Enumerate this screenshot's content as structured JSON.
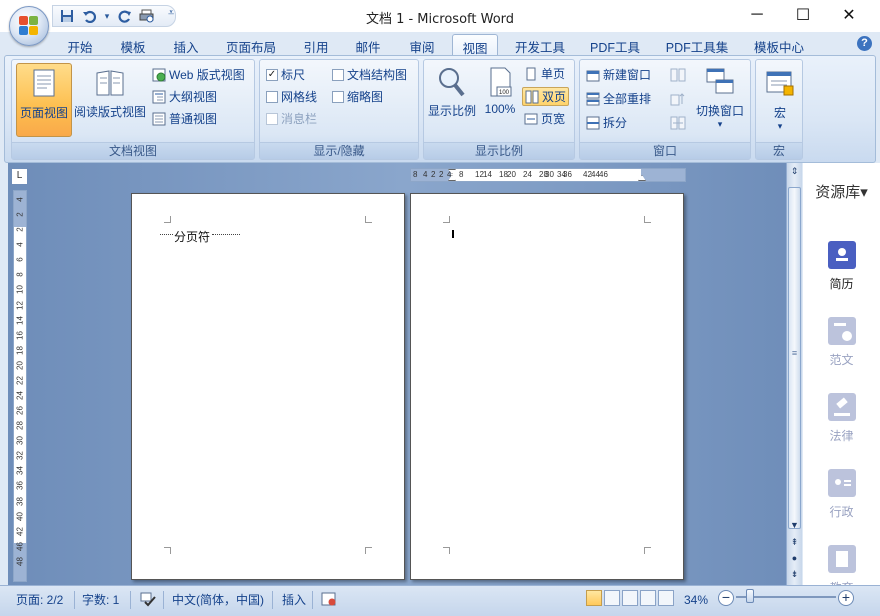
{
  "window": {
    "title": "文档 1 - Microsoft Word",
    "minimize_glyph": "─",
    "maximize_glyph": "☐",
    "close_glyph": "✕"
  },
  "quick_access": {
    "icons": [
      "save-icon",
      "undo-icon",
      "redo-icon",
      "print-preview-icon",
      "customize-dropdown-icon"
    ],
    "dropdown_glyph": "▾",
    "customize_glyph": "⩡"
  },
  "tabs": [
    {
      "label": "开始",
      "active": false
    },
    {
      "label": "模板",
      "active": false
    },
    {
      "label": "插入",
      "active": false
    },
    {
      "label": "页面布局",
      "active": false
    },
    {
      "label": "引用",
      "active": false
    },
    {
      "label": "邮件",
      "active": false
    },
    {
      "label": "审阅",
      "active": false
    },
    {
      "label": "视图",
      "active": true
    },
    {
      "label": "开发工具",
      "active": false
    },
    {
      "label": "PDF工具",
      "active": false
    },
    {
      "label": "PDF工具集",
      "active": false
    },
    {
      "label": "模板中心",
      "active": false
    }
  ],
  "help_glyph": "?",
  "ribbon": {
    "doc_views": {
      "label": "文档视图",
      "page_view": "页面视图",
      "reading_view": "阅读版式视图",
      "web_view": "Web 版式视图",
      "outline_view": "大纲视图",
      "draft_view": "普通视图"
    },
    "show_hide": {
      "label": "显示/隐藏",
      "ruler": "标尺",
      "ruler_checked": true,
      "gridlines": "网格线",
      "gridlines_checked": false,
      "message_bar": "消息栏",
      "message_bar_checked": false,
      "doc_map": "文档结构图",
      "doc_map_checked": false,
      "thumbnails": "缩略图",
      "thumbnails_checked": false,
      "check_glyph": "✓"
    },
    "zoom": {
      "label": "显示比例",
      "zoom_btn": "显示比例",
      "percent_btn": "100%",
      "percent_icon_text": "100",
      "one_page": "单页",
      "two_pages": "双页",
      "page_width": "页宽"
    },
    "window": {
      "label": "窗口",
      "new_window": "新建窗口",
      "arrange_all": "全部重排",
      "split": "拆分",
      "switch_windows": "切换窗口",
      "dropdown_glyph": "▾"
    },
    "macros": {
      "label": "宏",
      "macros_btn": "宏",
      "dropdown_glyph": "▾"
    }
  },
  "rulers": {
    "tab_selector": "L",
    "h_ticks": [
      "8",
      "4",
      "2",
      "2",
      "4",
      "8",
      "12",
      "14",
      "18",
      "20",
      "24",
      "28",
      "30",
      "34",
      "36",
      "42",
      "44",
      "46"
    ],
    "v_ticks": [
      "4",
      "2",
      "2",
      "4",
      "6",
      "8",
      "10",
      "12",
      "14",
      "16",
      "18",
      "20",
      "22",
      "24",
      "26",
      "28",
      "30",
      "32",
      "34",
      "36",
      "38",
      "40",
      "42",
      "46",
      "48"
    ]
  },
  "document": {
    "page_break": "分页符"
  },
  "scrollbar": {
    "up": "▲",
    "down": "▼",
    "prev_page": "⇞",
    "browse_object": "●",
    "next_page": "⇟",
    "grip": "≡",
    "split_glyph": "⇕"
  },
  "resource_pane": {
    "header": "资源库▾",
    "items": [
      {
        "label": "简历",
        "color": "#4a5fc1",
        "active": true
      },
      {
        "label": "范文",
        "color": "#9aa3c2",
        "active": false
      },
      {
        "label": "法律",
        "color": "#9aa3c2",
        "active": false
      },
      {
        "label": "行政",
        "color": "#9aa3c2",
        "active": false
      },
      {
        "label": "教育",
        "color": "#9aa3c2",
        "active": false
      }
    ]
  },
  "status": {
    "page": "页面: 2/2",
    "words": "字数: 1",
    "language": "中文(简体，中国)",
    "mode": "插入",
    "zoom": "34%",
    "zoom_minus": "−",
    "zoom_plus": "+"
  }
}
